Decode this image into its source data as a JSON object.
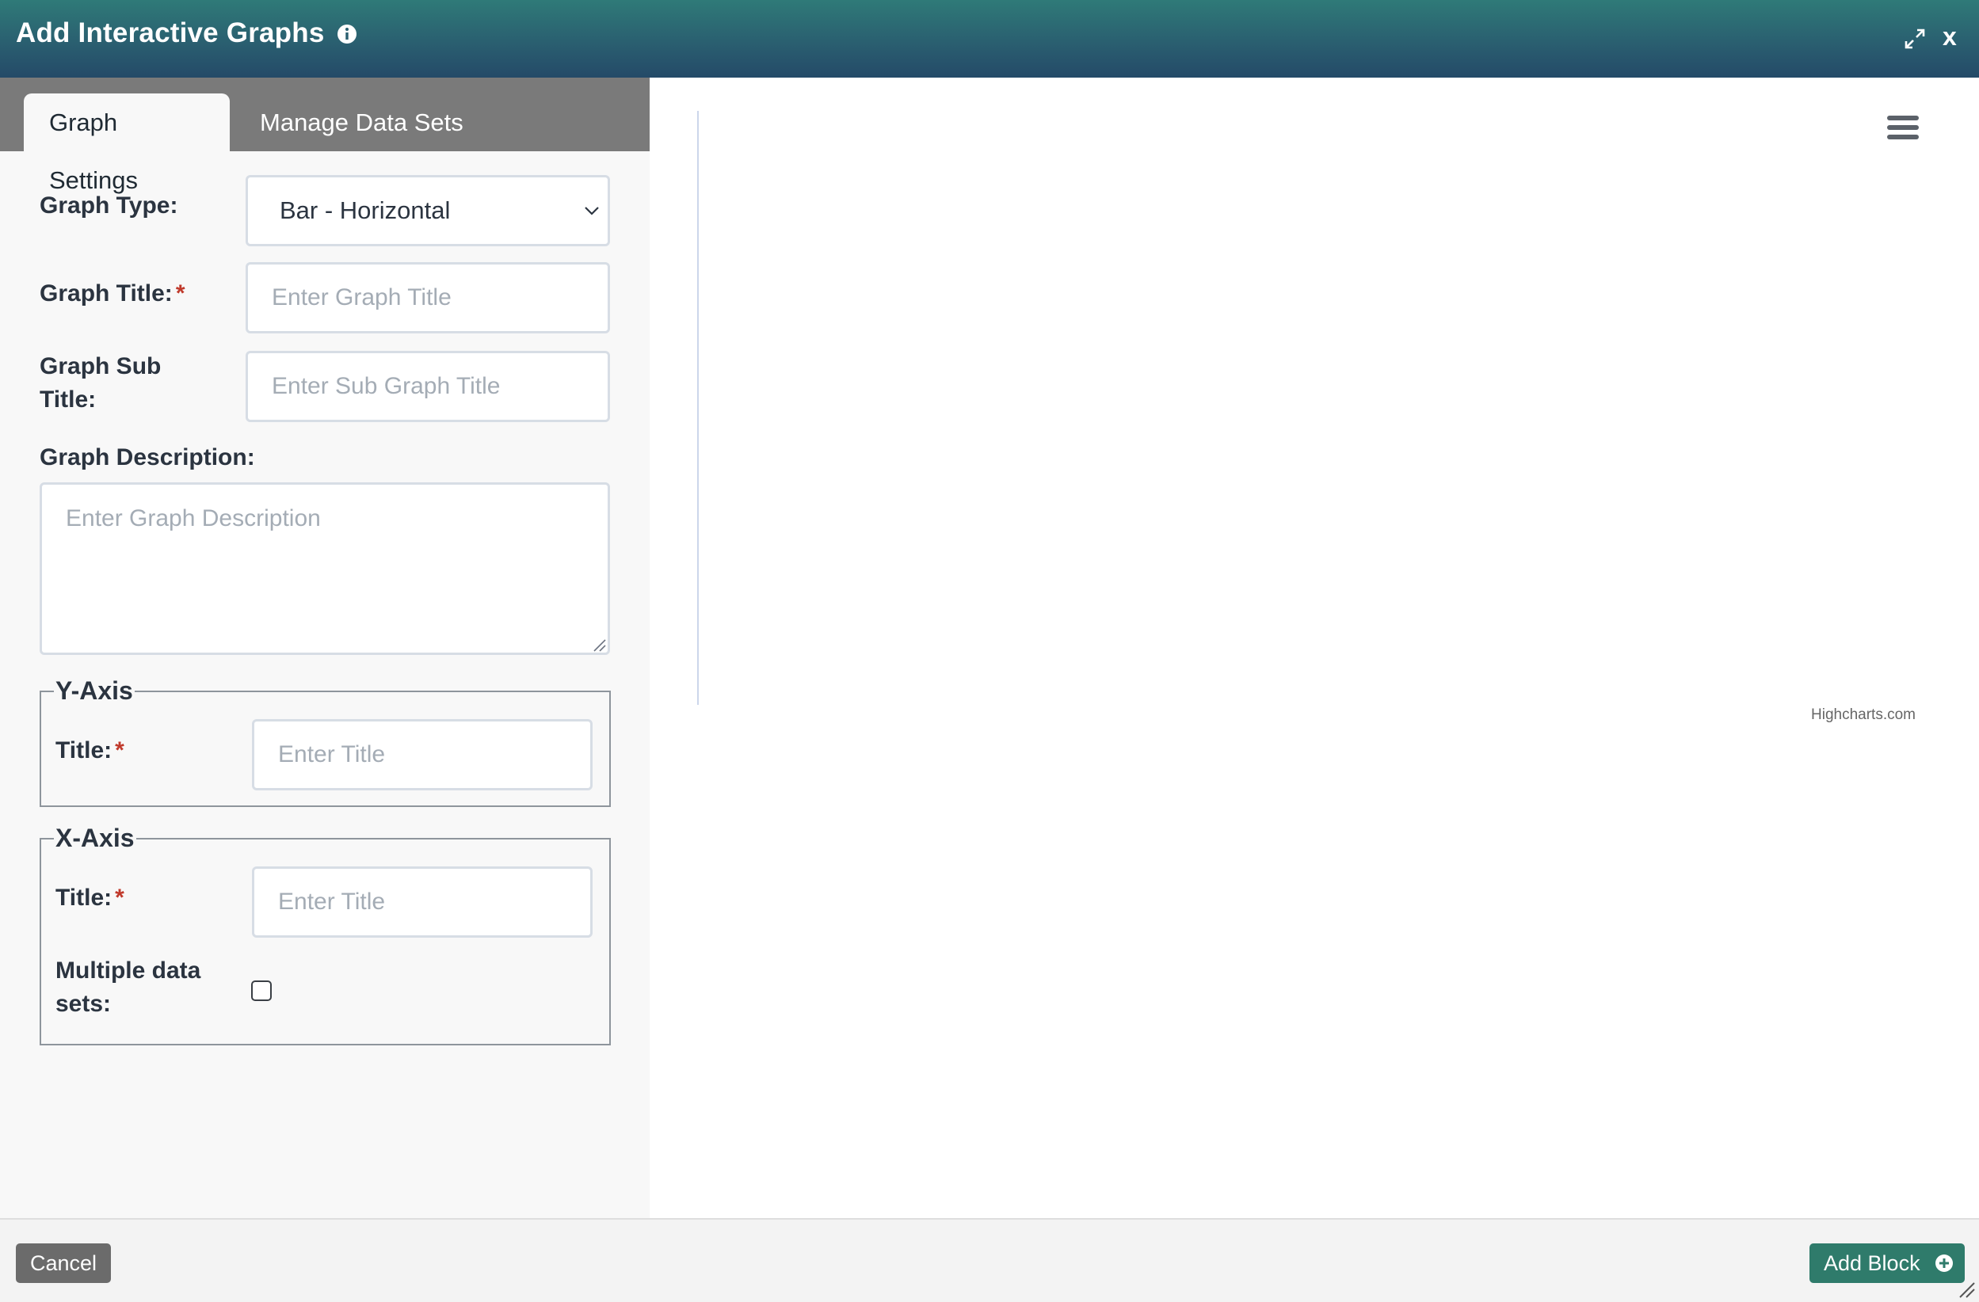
{
  "header": {
    "title": "Add Interactive Graphs",
    "close_label": "x"
  },
  "tabs": [
    {
      "label": "Graph Settings",
      "active": true
    },
    {
      "label": "Manage Data Sets",
      "active": false
    }
  ],
  "form": {
    "graph_type": {
      "label": "Graph Type:",
      "value": "Bar - Horizontal"
    },
    "graph_title": {
      "label": "Graph Title:",
      "required": "*",
      "placeholder": "Enter Graph Title"
    },
    "graph_subtitle": {
      "label_line1": "Graph Sub",
      "label_line2": "Title:",
      "placeholder": "Enter Sub Graph Title"
    },
    "graph_description": {
      "label": "Graph Description:",
      "placeholder": "Enter Graph Description"
    },
    "y_axis": {
      "legend": "Y-Axis",
      "title_label": "Title:",
      "required": "*",
      "placeholder": "Enter Title"
    },
    "x_axis": {
      "legend": "X-Axis",
      "title_label": "Title:",
      "required": "*",
      "placeholder": "Enter Title",
      "multiple_label_line1": "Multiple data",
      "multiple_label_line2": "sets:"
    }
  },
  "chart": {
    "credits": "Highcharts.com"
  },
  "footer": {
    "cancel_label": "Cancel",
    "add_label": "Add Block"
  },
  "colors": {
    "header_start": "#2f7a78",
    "header_end": "#244a68",
    "add_button": "#2f7b6b",
    "cancel_button": "#6b6b6b",
    "required": "#c0392b"
  }
}
